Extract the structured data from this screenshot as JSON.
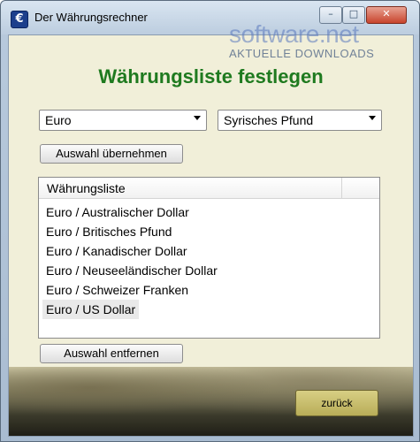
{
  "window": {
    "title": "Der Währungsrechner",
    "app_icon": "€",
    "controls": {
      "minimize": "–",
      "maximize": "□",
      "close": "✕"
    }
  },
  "watermark": {
    "main": "software.net",
    "sub": "AKTUELLE DOWNLOADS"
  },
  "heading": "Währungsliste festlegen",
  "selects": {
    "from": "Euro",
    "to": "Syrisches Pfund"
  },
  "buttons": {
    "apply": "Auswahl übernehmen",
    "remove": "Auswahl entfernen",
    "back": "zurück"
  },
  "list": {
    "header": "Währungsliste",
    "rows": [
      "Euro / Australischer Dollar",
      "Euro / Britisches Pfund",
      "Euro / Kanadischer Dollar",
      "Euro / Neuseeländischer Dollar",
      "Euro / Schweizer Franken",
      "Euro / US Dollar"
    ],
    "selected_index": 5
  },
  "colors": {
    "heading": "#1f7a1f",
    "client_bg": "#f1efd9",
    "back_button": "#c8be6c"
  }
}
